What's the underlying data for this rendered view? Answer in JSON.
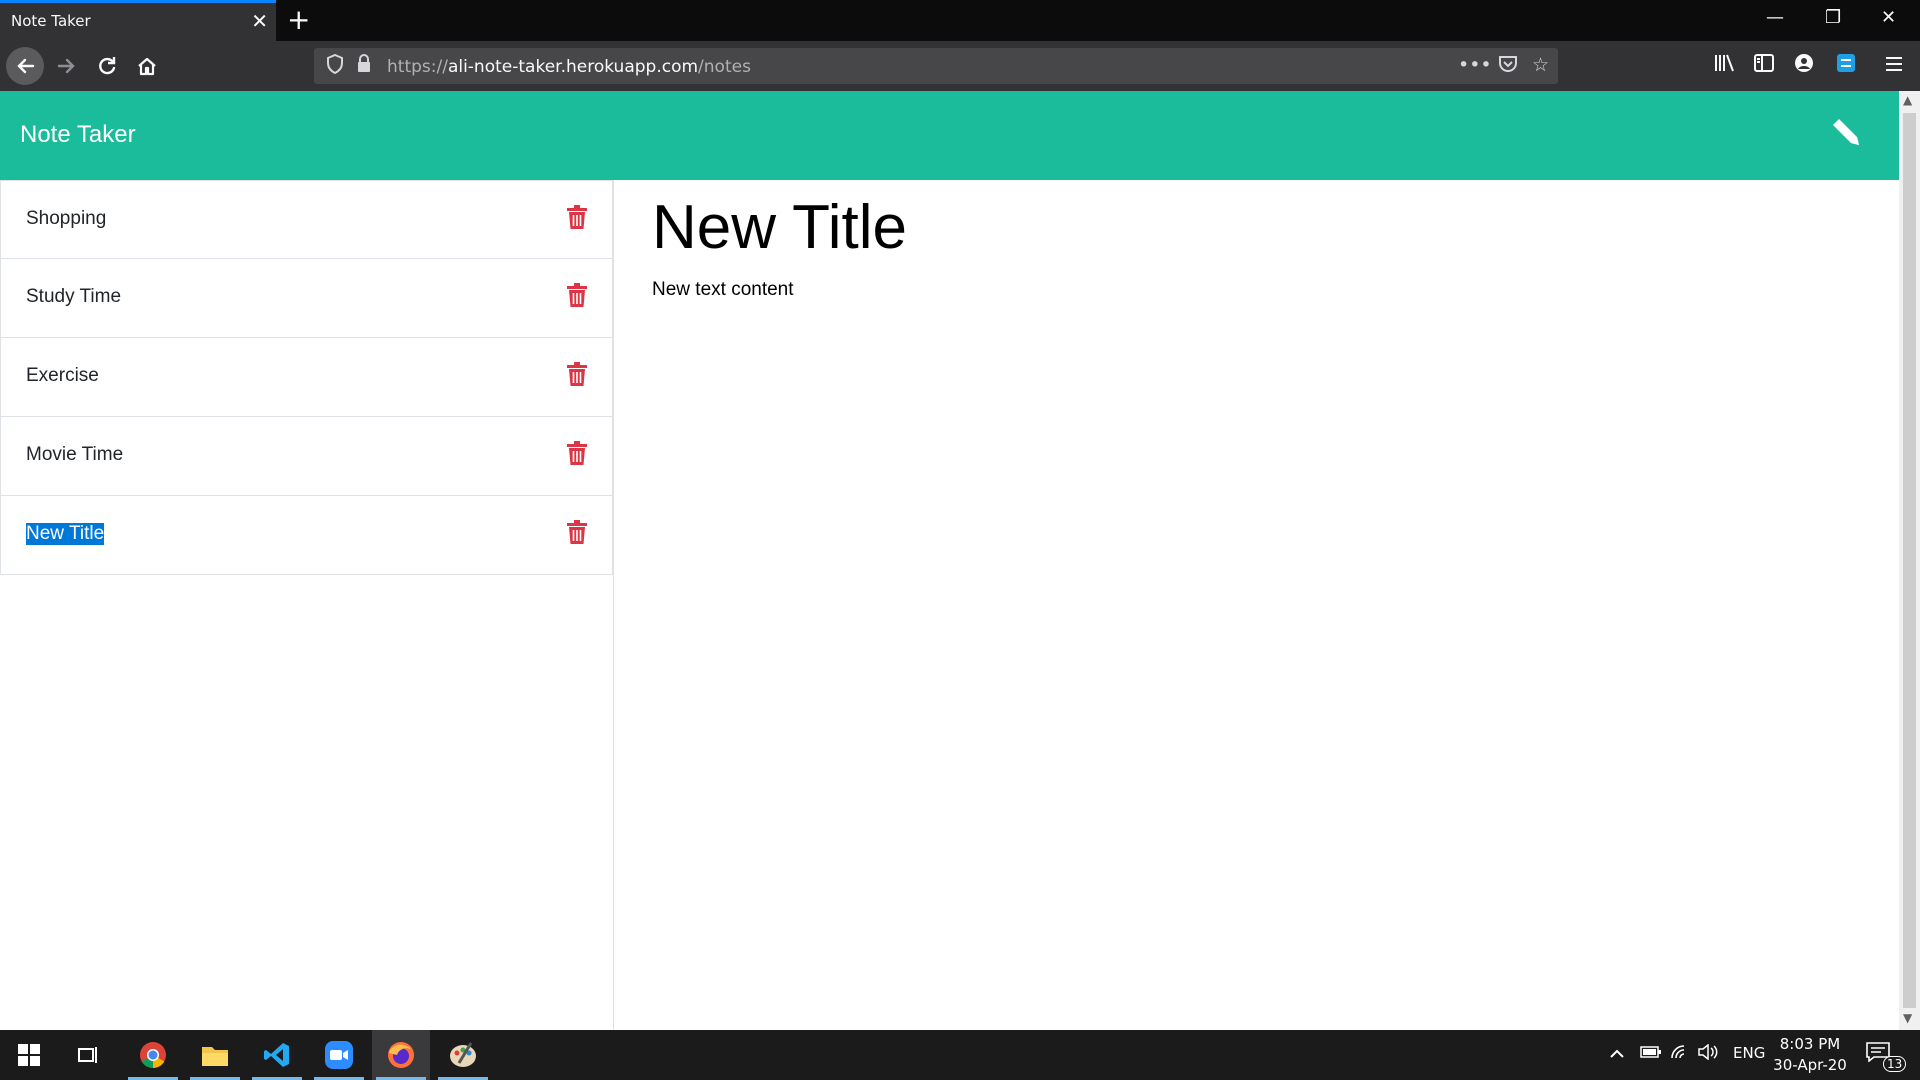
{
  "browser": {
    "tab_title": "Note Taker",
    "tab_close": "✕",
    "new_tab": "+",
    "url_scheme": "https://",
    "url_host": "ali-note-taker.herokuapp.com",
    "url_path": "/notes",
    "window_controls": {
      "minimize": "—",
      "restore": "❐",
      "close": "✕"
    },
    "icons": {
      "back": "arrow-left-icon",
      "forward": "arrow-right-icon",
      "reload": "reload-icon",
      "home": "home-icon",
      "page_actions": "more-actions-icon",
      "pocket": "pocket-icon",
      "bookmark": "star-icon",
      "library": "library-icon",
      "sidebar": "sidebar-icon",
      "account": "account-icon",
      "extension": "extension-icon",
      "menu": "hamburger-menu-icon"
    }
  },
  "app": {
    "title": "Note Taker",
    "header_color": "#1abc9c",
    "trash_color": "#dc3545",
    "notes": [
      {
        "label": "Shopping",
        "selected": false
      },
      {
        "label": "Study Time",
        "selected": false
      },
      {
        "label": "Exercise",
        "selected": false
      },
      {
        "label": "Movie Time",
        "selected": false
      },
      {
        "label": "New Title",
        "selected": true
      }
    ],
    "active_note": {
      "title": "New Title",
      "body": "New text content"
    }
  },
  "taskbar": {
    "apps": [
      "windows-start-icon",
      "task-view-icon",
      "chrome-icon",
      "file-explorer-icon",
      "vscode-icon",
      "zoom-icon",
      "firefox-icon",
      "paint-icon"
    ],
    "language": "ENG",
    "time": "8:03 PM",
    "date": "30-Apr-20",
    "notification_count": "13"
  }
}
